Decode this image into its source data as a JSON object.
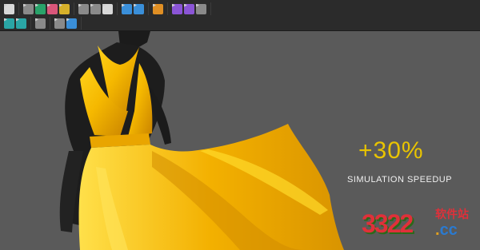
{
  "toolbar": {
    "row1": [
      {
        "group": "select",
        "tools": [
          {
            "icon": "arrow-down-icon",
            "color": "c-white"
          }
        ]
      },
      {
        "group": "garment",
        "tools": [
          {
            "icon": "move-icon",
            "color": "c-gray"
          },
          {
            "icon": "shirt-icon",
            "color": "c-green"
          },
          {
            "icon": "shirt-edit-icon",
            "color": "c-pink"
          },
          {
            "icon": "texture-icon",
            "color": "c-yellow"
          }
        ]
      },
      {
        "group": "pattern",
        "tools": [
          {
            "icon": "sew-icon",
            "color": "c-gray"
          },
          {
            "icon": "pattern-icon",
            "color": "c-gray"
          },
          {
            "icon": "fold-icon",
            "color": "c-white"
          }
        ]
      },
      {
        "group": "pins",
        "tools": [
          {
            "icon": "pin-icon",
            "color": "c-blue"
          },
          {
            "icon": "tack-icon",
            "color": "c-blue"
          }
        ]
      },
      {
        "group": "avatar",
        "tools": [
          {
            "icon": "figure-run-icon",
            "color": "c-orange"
          }
        ]
      },
      {
        "group": "measure",
        "tools": [
          {
            "icon": "measure-icon",
            "color": "c-purple"
          },
          {
            "icon": "circle-measure-icon",
            "color": "c-purple"
          },
          {
            "icon": "figure-icon",
            "color": "c-gray"
          }
        ]
      }
    ],
    "row2": [
      {
        "group": "arrange",
        "tools": [
          {
            "icon": "arrange-icon",
            "color": "c-teal"
          },
          {
            "icon": "grid-icon",
            "color": "c-teal"
          }
        ]
      },
      {
        "group": "body",
        "tools": [
          {
            "icon": "body-icon",
            "color": "c-gray"
          }
        ]
      },
      {
        "group": "render",
        "tools": [
          {
            "icon": "render-icon",
            "color": "c-gray"
          },
          {
            "icon": "render-settings-icon",
            "color": "c-blue"
          }
        ]
      }
    ]
  },
  "viewport": {
    "headline": "+30%",
    "subheadline": "SIMULATION SPEEDUP",
    "dress_color": "#f5b800",
    "background_color": "#5a5a5a"
  },
  "watermark": {
    "number": "3322",
    "site_label": "软件站",
    "domain_dot": ".",
    "domain": "cc"
  }
}
